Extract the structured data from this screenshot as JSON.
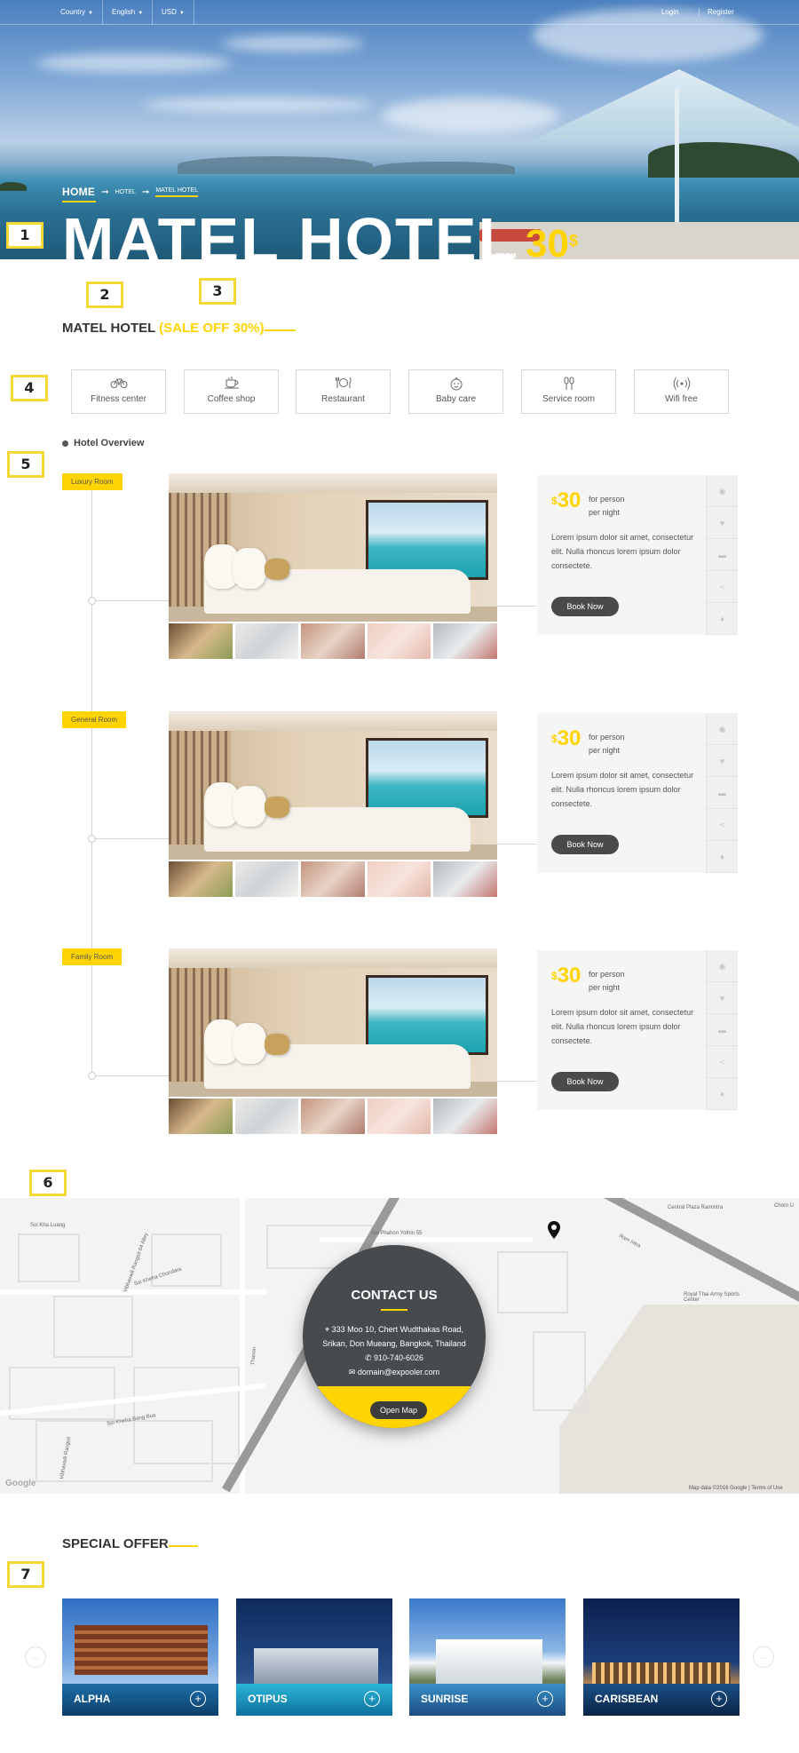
{
  "topbar": {
    "country": "Country",
    "language": "English",
    "currency": "USD",
    "login": "Login",
    "register": "Register"
  },
  "breadcrumb": {
    "home": "HOME",
    "hotel": "HOTEL",
    "current": "MATEL HOTEL"
  },
  "hero": {
    "title": "MATEL HOTEL",
    "from": "FROM",
    "price": "30",
    "currency_symbol": "$"
  },
  "markers": [
    "1",
    "2",
    "3",
    "4",
    "5",
    "6",
    "7"
  ],
  "hotel": {
    "name": "MATEL HOTEL",
    "sale": "(SALE OFF 30%)"
  },
  "amenities": [
    {
      "label": "Fitness center",
      "icon": "bicycle-icon"
    },
    {
      "label": "Coffee shop",
      "icon": "coffee-cup-icon"
    },
    {
      "label": "Restaurant",
      "icon": "dining-icon"
    },
    {
      "label": "Baby care",
      "icon": "baby-icon"
    },
    {
      "label": "Service room",
      "icon": "service-icon"
    },
    {
      "label": "Wifi free",
      "icon": "wifi-icon"
    }
  ],
  "overview": {
    "title": "Hotel Overview",
    "rooms": [
      {
        "tag": "Luxury Room",
        "currency": "$",
        "price": "30",
        "per_person": "for person",
        "per_night": "per night",
        "desc": "Lorem ipsum dolor sit amet, consectetur elit. Nulla rhoncus lorem ipsum dolor consectete.",
        "book": "Book Now"
      },
      {
        "tag": "General Room",
        "currency": "$",
        "price": "30",
        "per_person": "for person",
        "per_night": "per night",
        "desc": "Lorem ipsum dolor sit amet, consectetur elit. Nulla rhoncus lorem ipsum dolor consectete.",
        "book": "Book Now"
      },
      {
        "tag": "Family Room",
        "currency": "$",
        "price": "30",
        "per_person": "for person",
        "per_night": "per night",
        "desc": "Lorem ipsum dolor sit amet, consectetur elit. Nulla rhoncus lorem ipsum dolor consectete.",
        "book": "Book Now"
      }
    ],
    "side_icons": [
      "eye-icon",
      "heart-icon",
      "comment-icon",
      "share-icon",
      "location-pin-icon"
    ]
  },
  "map": {
    "labels": [
      "Soi Kha Luang",
      "Vibhavadi Rangsit 64 Alley",
      "Soi Phahon Yothin 55",
      "Soi Kheha Chondara",
      "Thanon",
      "Soi Kheha Bang Bua",
      "Vibhavadi Rangsit",
      "Central Plaza Ramintra",
      "Royal Thai Army Sports Center",
      "Ram Intra",
      "Chom U",
      "Google"
    ],
    "copyright": "Map data ©2016 Google  |  Terms of Use"
  },
  "contact": {
    "title": "CONTACT US",
    "address": "333 Moo 10, Chert Wudthakas Road, Srikan, Don Mueang, Bangkok, Thailand",
    "phone": "910-740-6026",
    "email": "domain@expooler.com",
    "button": "Open Map"
  },
  "special_offer": {
    "title": "SPECIAL OFFER",
    "items": [
      "ALPHA",
      "OTIPUS",
      "SUNRISE",
      "CARISBEAN"
    ],
    "plus": "+",
    "prev": "←",
    "next": "→"
  },
  "colors": {
    "accent": "#ffd400",
    "dark": "#474b4e",
    "button": "#4a4a4a"
  }
}
